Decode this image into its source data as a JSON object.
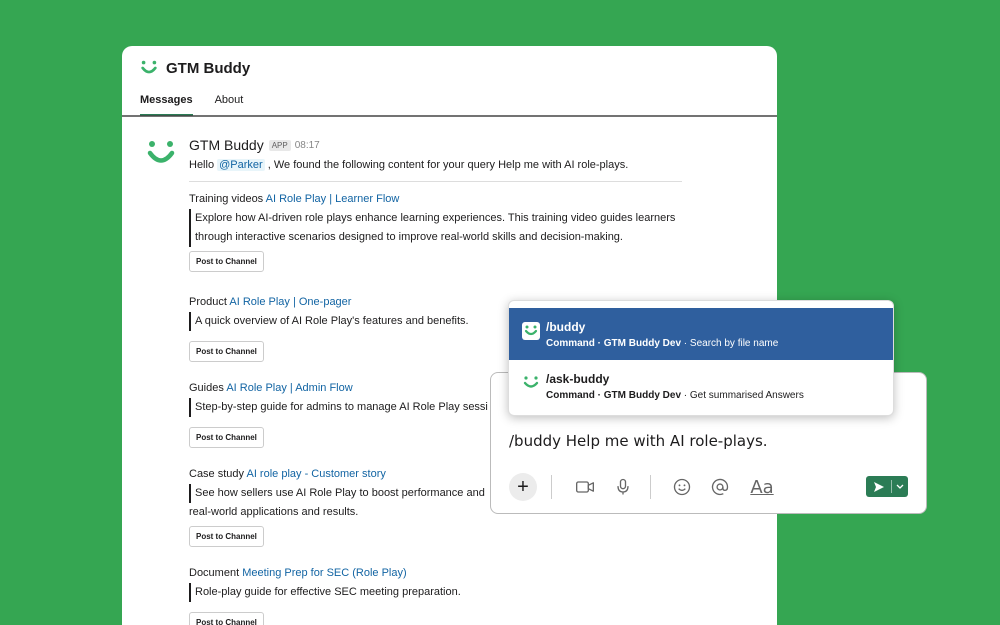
{
  "window": {
    "app_name": "GTM Buddy",
    "tabs": [
      {
        "label": "Messages",
        "active": true
      },
      {
        "label": "About",
        "active": false
      }
    ]
  },
  "message": {
    "sender": "GTM Buddy",
    "badge": "APP",
    "time": "08:17",
    "intro_prefix": "Hello ",
    "mention": "@Parker",
    "intro_suffix": " , We found the following content for your query Help me with AI role-plays.",
    "items": [
      {
        "category": "Training videos",
        "link": "AI Role Play | Learner Flow",
        "description": "Explore how AI-driven role plays enhance learning experiences. This training video guides learners through interactive scenarios designed to improve real-world skills and decision-making.",
        "button": "Post to Channel"
      },
      {
        "category": "Product",
        "link": "AI Role Play | One-pager",
        "description": "A quick overview of AI Role Play's features and benefits.",
        "button": "Post to Channel"
      },
      {
        "category": "Guides",
        "link": "AI Role Play | Admin Flow",
        "description": "Step-by-step guide for admins to manage AI Role Play sessi",
        "button": "Post to Channel"
      },
      {
        "category": "Case study",
        "link": "AI role play - Customer story",
        "description": "See how sellers use AI Role Play to boost performance and",
        "description_cont": "real-world applications and results.",
        "button": "Post to Channel"
      },
      {
        "category": "Document",
        "link": "Meeting Prep for SEC (Role Play)",
        "description": "Role-play guide for effective SEC meeting preparation.",
        "button": "Post to Channel"
      }
    ]
  },
  "popup": {
    "options": [
      {
        "name": "/buddy",
        "meta_bold": "Command · GTM Buddy Dev",
        "meta": " · Search by file name",
        "selected": true
      },
      {
        "name": "/ask-buddy",
        "meta_bold": "Command · GTM Buddy Dev",
        "meta": " · Get summarised Answers",
        "selected": false
      }
    ]
  },
  "composer": {
    "text": "/buddy Help me with AI role-plays.",
    "format_label": "Aa"
  },
  "colors": {
    "background": "#35a652",
    "brand_green": "#2b7c55",
    "selected_row": "#2f5f9e",
    "link": "#1264a3"
  }
}
